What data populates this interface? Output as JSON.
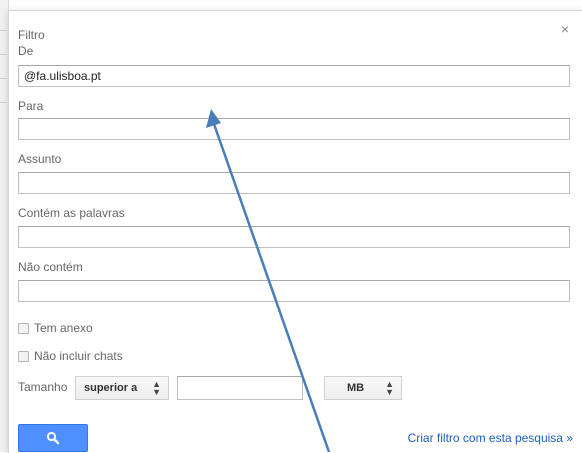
{
  "dialog": {
    "title": "Filtro",
    "close_glyph": "×"
  },
  "fields": {
    "from": {
      "label": "De",
      "value": "@fa.ulisboa.pt"
    },
    "to": {
      "label": "Para",
      "value": ""
    },
    "subject": {
      "label": "Assunto",
      "value": ""
    },
    "has_words": {
      "label": "Contém as palavras",
      "value": ""
    },
    "doesnt_have": {
      "label": "Não contém",
      "value": ""
    }
  },
  "checkboxes": {
    "has_attachment": {
      "label": "Tem anexo",
      "checked": false
    },
    "exclude_chats": {
      "label": "Não incluir chats",
      "checked": false
    }
  },
  "size": {
    "label": "Tamanho",
    "operator": "superior a",
    "value": "",
    "unit": "MB"
  },
  "actions": {
    "search_icon": "search-icon",
    "create_filter_label": "Criar filtro com esta pesquisa »"
  },
  "colors": {
    "button_blue": "#4d90fe",
    "link_blue": "#1a5ec2",
    "annotation_arrow": "#4a7ebb"
  }
}
